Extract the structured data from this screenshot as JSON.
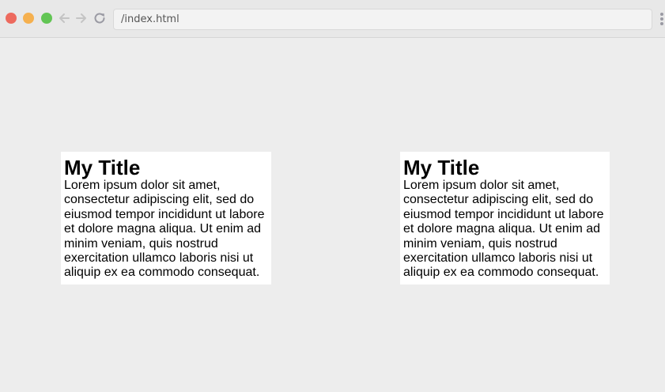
{
  "browser": {
    "url": "/index.html",
    "icons": {
      "back": "arrow-left-icon",
      "forward": "arrow-right-icon",
      "reload": "reload-icon",
      "menu": "vertical-dots-icon"
    }
  },
  "cards": [
    {
      "title": "My Title",
      "body": "Lorem ipsum dolor sit amet, consectetur adipiscing elit, sed do eiusmod tempor incididunt ut labore et dolore magna aliqua. Ut enim ad minim veniam, quis nostrud exercitation ullamco laboris nisi ut aliquip ex ea commodo consequat."
    },
    {
      "title": "My Title",
      "body": "Lorem ipsum dolor sit amet, consectetur adipiscing elit, sed do eiusmod tempor incididunt ut labore et dolore magna aliqua. Ut enim ad minim veniam, quis nostrud exercitation ullamco laboris nisi ut aliquip ex ea commodo consequat."
    }
  ]
}
